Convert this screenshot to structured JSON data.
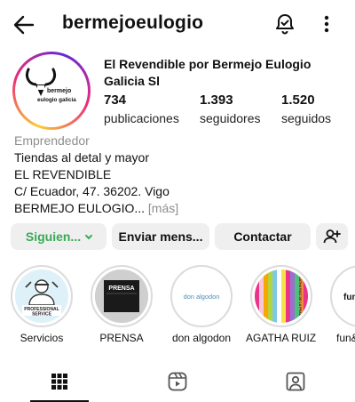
{
  "header": {
    "username": "bermejoeulogio",
    "back_icon": "arrow-left-icon",
    "bell_icon": "bell-icon",
    "more_icon": "more-vertical-icon"
  },
  "profile": {
    "avatar_text_line1": "bermejo",
    "avatar_text_line2": "eulogio galicia",
    "full_name": "El Revendible por Bermejo Eulogio Galicia Sl",
    "stats": [
      {
        "value": "734",
        "label": "publicaciones"
      },
      {
        "value": "1.393",
        "label": "seguidores"
      },
      {
        "value": "1.520",
        "label": "seguidos"
      }
    ],
    "bio": {
      "category": "Emprendedor",
      "lines": [
        "Tiendas al detal y mayor",
        "EL REVENDIBLE",
        "C/ Ecuador, 47. 36202. Vigo",
        "BERMEJO EULOGIO..."
      ],
      "more_label": "[más]"
    }
  },
  "actions": {
    "following": "Siguien...",
    "message": "Enviar mens...",
    "contact": "Contactar",
    "add_user_icon": "add-user-icon"
  },
  "highlights": [
    {
      "label": "Servicios",
      "image_text": "PROFESSIONAL SERVICE"
    },
    {
      "label": "PRENSA",
      "image_text": "PRENSA"
    },
    {
      "label": "don algodon",
      "image_text": "don algodon"
    },
    {
      "label": "AGATHA RUIZ...",
      "image_text": "AGATHA RUIZ DE LA PRADA"
    },
    {
      "label": "fun&...",
      "image_text": "fun"
    }
  ],
  "tabs": [
    {
      "name": "grid",
      "icon": "grid-icon"
    },
    {
      "name": "reels",
      "icon": "reels-icon"
    },
    {
      "name": "tagged",
      "icon": "tagged-user-icon"
    }
  ],
  "colors": {
    "following_text": "#3aa957",
    "button_bg": "#efefef",
    "muted_text": "#8e8e8e"
  }
}
